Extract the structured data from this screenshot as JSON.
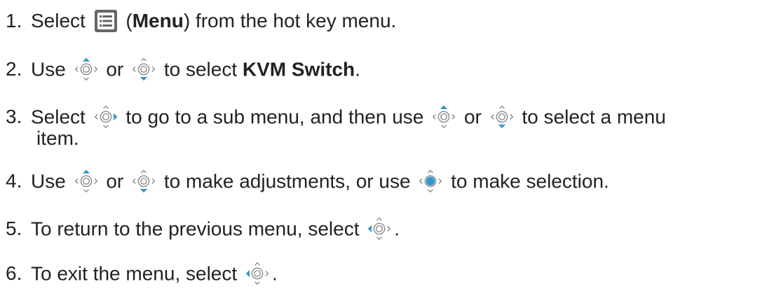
{
  "steps": [
    {
      "number": "1.",
      "t1": "Select",
      "t2": "(",
      "bold": "Menu",
      "t3": ") from the hot key menu."
    },
    {
      "number": "2.",
      "t1": "Use",
      "t2": "or",
      "t3": "to select",
      "bold": "KVM Switch",
      "t4": "."
    },
    {
      "number": "3.",
      "t1": "Select",
      "t2": "to go to a sub menu, and then use",
      "t3": "or",
      "t4": "to select a menu",
      "t5": "item."
    },
    {
      "number": "4.",
      "t1": "Use",
      "t2": "or",
      "t3": "to make adjustments, or use",
      "t4": "to make selection."
    },
    {
      "number": "5.",
      "t1": "To return to the previous menu, select",
      "t2": "."
    },
    {
      "number": "6.",
      "t1": "To exit the menu, select",
      "t2": "."
    }
  ],
  "icons": {
    "menu": "menu-icon",
    "joystick_up": "joystick-up-icon",
    "joystick_down": "joystick-down-icon",
    "joystick_right": "joystick-right-icon",
    "joystick_left": "joystick-left-icon",
    "joystick_press": "joystick-press-icon"
  },
  "colors": {
    "text": "#222222",
    "accent": "#3399CC",
    "icon_gray": "#888888"
  }
}
